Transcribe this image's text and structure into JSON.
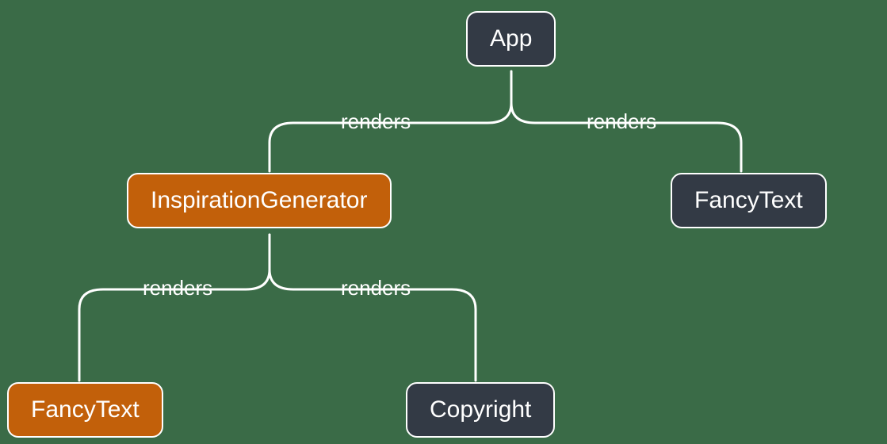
{
  "diagram": {
    "nodes": {
      "app": {
        "label": "App",
        "type": "dark"
      },
      "inspiration_generator": {
        "label": "InspirationGenerator",
        "type": "orange"
      },
      "fancytext_right": {
        "label": "FancyText",
        "type": "dark"
      },
      "fancytext_left": {
        "label": "FancyText",
        "type": "orange"
      },
      "copyright": {
        "label": "Copyright",
        "type": "dark"
      }
    },
    "edges": {
      "app_to_inspiration": {
        "label": "renders"
      },
      "app_to_fancytext": {
        "label": "renders"
      },
      "inspiration_to_fancytext": {
        "label": "renders"
      },
      "inspiration_to_copyright": {
        "label": "renders"
      }
    }
  }
}
